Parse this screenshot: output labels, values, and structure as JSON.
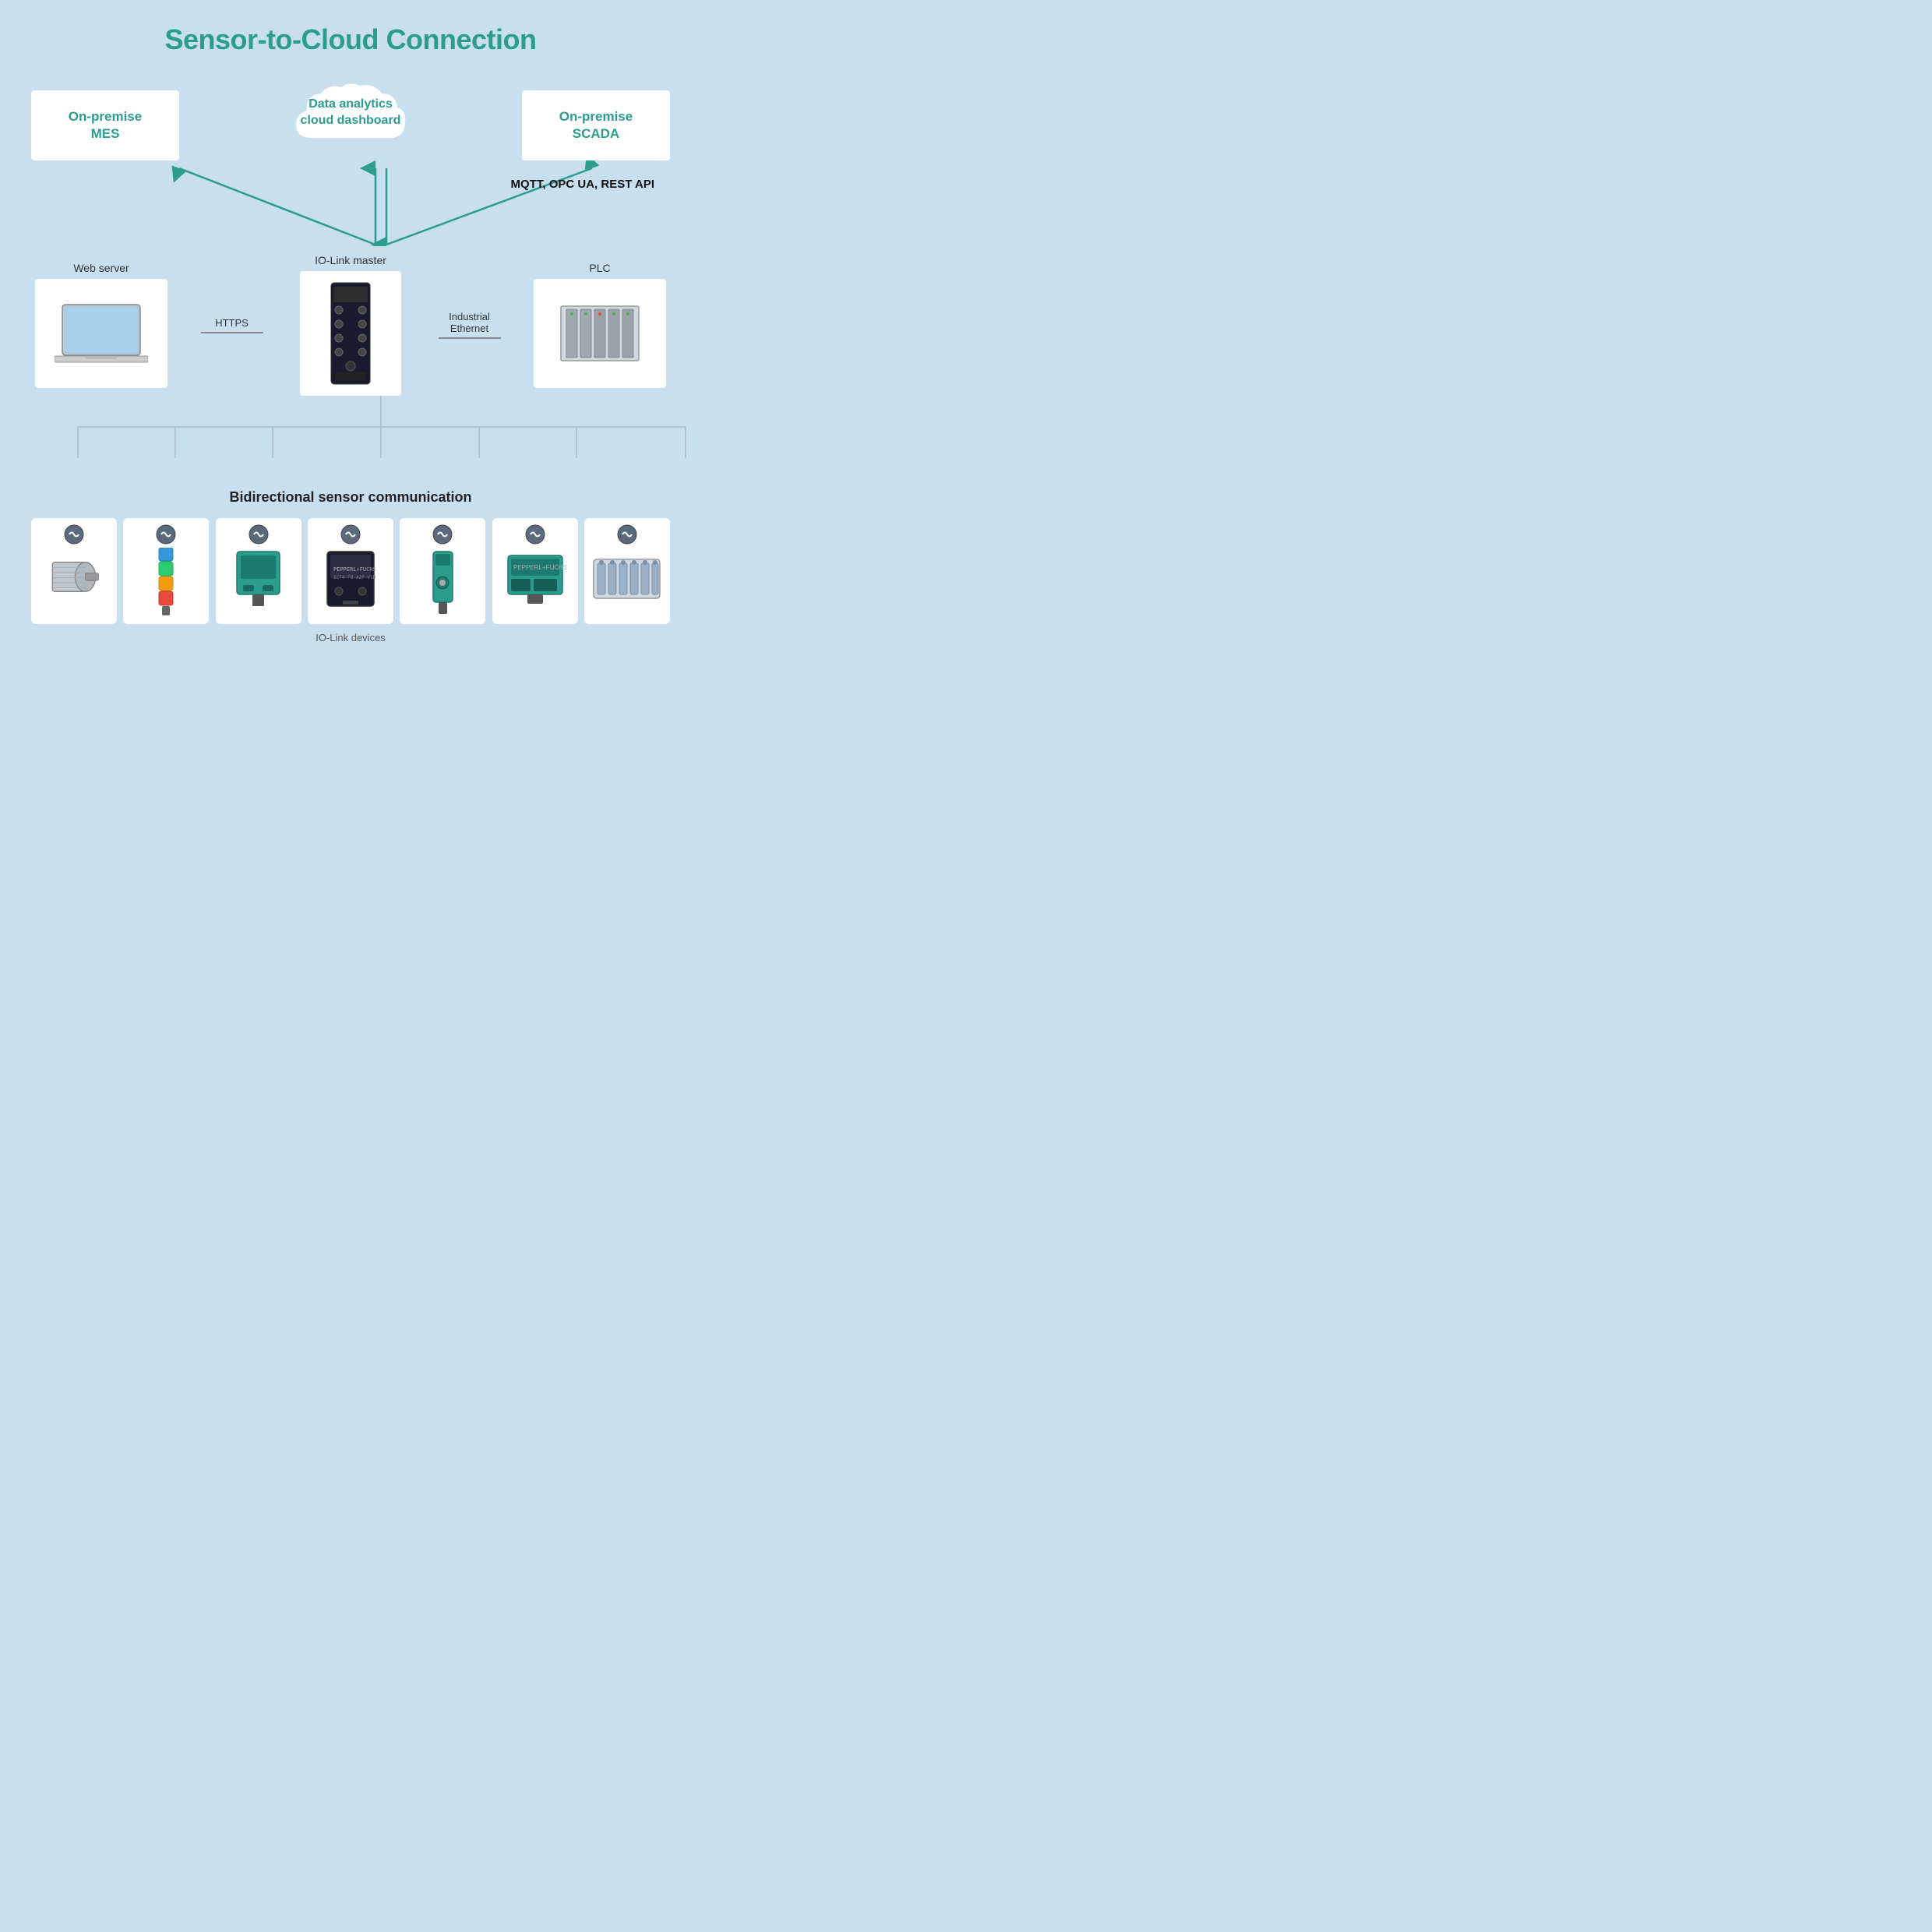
{
  "title": "Sensor-to-Cloud Connection",
  "top_boxes": {
    "left": {
      "label": "On-premise\nMES"
    },
    "center": {
      "label": "Data analytics\ncloud dashboard"
    },
    "right": {
      "label": "On-premise\nSCADA"
    }
  },
  "mqtt_label": "MQTT,\nOPC UA,\nREST API",
  "middle": {
    "webserver_label": "Web server",
    "iolink_label": "IO-Link master",
    "plc_label": "PLC",
    "https_label": "HTTPS",
    "ethernet_label": "Industrial\nEthernet"
  },
  "bottom": {
    "title": "Bidirectional sensor communication",
    "devices_label": "IO-Link devices"
  },
  "colors": {
    "teal": "#2a9d8f",
    "bg": "#c8dff0"
  }
}
